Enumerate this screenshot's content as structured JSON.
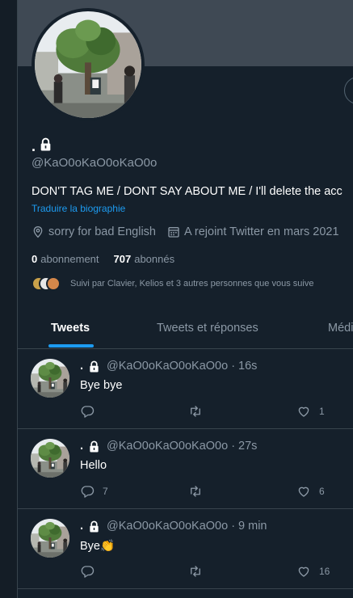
{
  "profile": {
    "display_name": ".",
    "handle": "@KaO0oKaO0oKaO0o",
    "bio": "DON'T TAG ME / DONT SAY ABOUT ME / I'll delete the acc",
    "translate_label": "Traduire la biographie",
    "location": "sorry for bad English",
    "joined": "A rejoint Twitter en mars 2021",
    "following_count": "0",
    "following_label": "abonnement",
    "followers_count": "707",
    "followers_label": "abonnés",
    "followed_by": "Suivi par Clavier, Kelios et 3 autres personnes que vous suive"
  },
  "tabs": [
    {
      "label": "Tweets",
      "active": true
    },
    {
      "label": "Tweets et réponses",
      "active": false
    },
    {
      "label": "Médi",
      "active": false
    }
  ],
  "tweets": [
    {
      "name": ".",
      "handle": "@KaO0oKaO0oKaO0o",
      "dot": "·",
      "time": "16s",
      "text": "Bye bye",
      "replies": "",
      "retweets": "",
      "likes": "1"
    },
    {
      "name": ".",
      "handle": "@KaO0oKaO0oKaO0o",
      "dot": "·",
      "time": "27s",
      "text": "Hello",
      "replies": "7",
      "retweets": "",
      "likes": "6"
    },
    {
      "name": ".",
      "handle": "@KaO0oKaO0oKaO0o",
      "dot": "·",
      "time": "9 min",
      "text": "Bye👏",
      "replies": "",
      "retweets": "",
      "likes": "16"
    }
  ],
  "icons": {
    "lock": "lock-icon",
    "location": "location-pin-icon",
    "calendar": "calendar-icon",
    "reply": "reply-icon",
    "retweet": "retweet-icon",
    "like": "heart-icon"
  },
  "colors": {
    "background": "#15202b",
    "accent": "#1d9bf0",
    "muted_text": "#8b98a5",
    "divider": "#38444d",
    "banner": "#3f4954"
  }
}
